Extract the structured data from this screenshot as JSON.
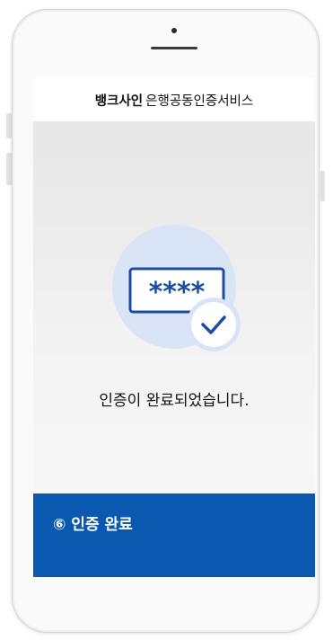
{
  "header": {
    "brand": "뱅크사인",
    "service": "은행공동인증서비스"
  },
  "illustration": {
    "password_mask": "****",
    "icon": "password-check-icon",
    "circle_color": "#d9e4f7",
    "accent_color": "#1c4ca5"
  },
  "message": "인증이 완료되었습니다.",
  "step": {
    "label": "⑥ 인증 완료",
    "color": "#0a58b0"
  }
}
